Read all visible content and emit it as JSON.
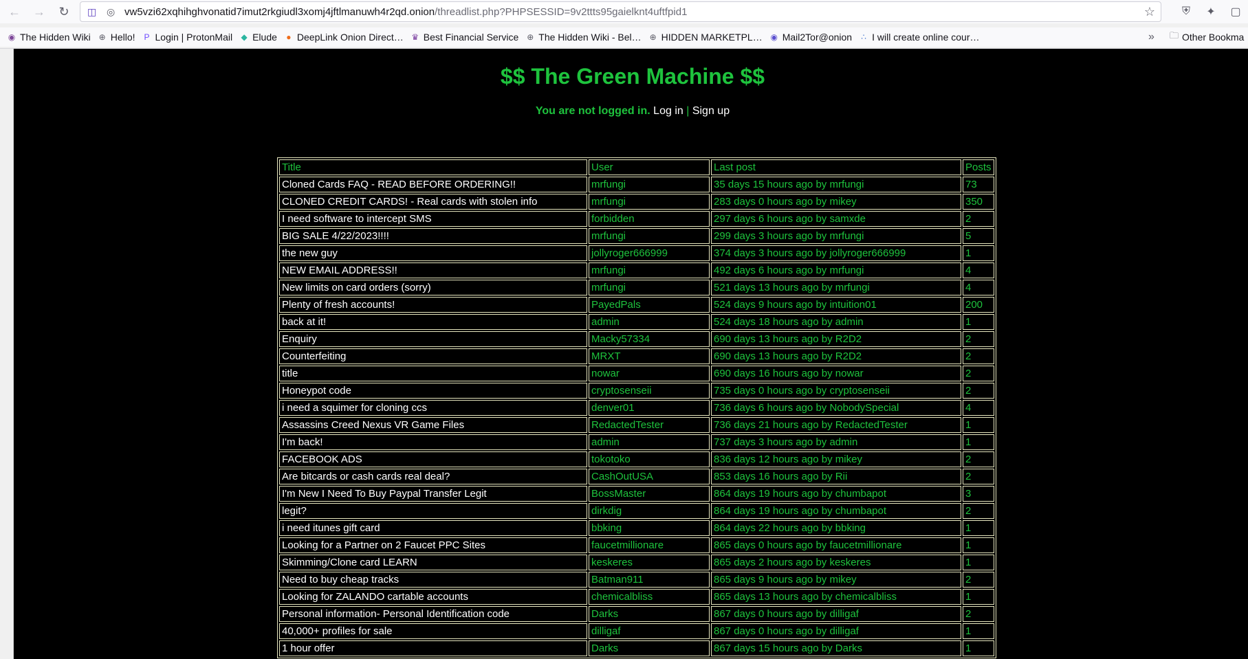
{
  "browser": {
    "url_host": "vw5vzi62xqhihghvonatid7imut2rkgiudl3xomj4jftlmanuwh4r2qd.onion",
    "url_path": "/threadlist.php?PHPSESSID=9v2ttts95gaielknt4uftfpid1",
    "icons": [
      "back-icon",
      "forward-icon",
      "reload-icon",
      "tor-circuit-icon",
      "bookmark-star-icon",
      "shield-icon",
      "magic-wand-icon",
      "extensions-icon"
    ]
  },
  "bookmarks": {
    "items": [
      {
        "label": "The Hidden Wiki",
        "icon": "onion-icon",
        "color": "#7d4698"
      },
      {
        "label": "Hello!",
        "icon": "globe-icon",
        "color": "#5b5b66"
      },
      {
        "label": "Login | ProtonMail",
        "icon": "proton-icon",
        "color": "#6d4aff"
      },
      {
        "label": "Elude",
        "icon": "elude-icon",
        "color": "#2bb5a0"
      },
      {
        "label": "DeepLink Onion Direct…",
        "icon": "deeplink-icon",
        "color": "#ef6c1a"
      },
      {
        "label": "Best Financial Service",
        "icon": "crown-icon",
        "color": "#7b3fa0"
      },
      {
        "label": "The Hidden Wiki - Bel…",
        "icon": "globe-icon",
        "color": "#5b5b66"
      },
      {
        "label": "HIDDEN MARKETPL…",
        "icon": "globe-icon",
        "color": "#5b5b66"
      },
      {
        "label": "Mail2Tor@onion",
        "icon": "mail2tor-icon",
        "color": "#5a4fcf"
      },
      {
        "label": "I will create online cour…",
        "icon": "network-icon",
        "color": "#4a7bd0"
      }
    ],
    "other_label": "Other Bookma"
  },
  "site": {
    "title": "$$ The Green Machine $$",
    "login_status": "You are not logged in.",
    "login_link": "Log in",
    "separator": "|",
    "signup_link": "Sign up"
  },
  "table": {
    "headers": {
      "title": "Title",
      "user": "User",
      "last_post": "Last post",
      "posts": "Posts"
    },
    "rows": [
      {
        "title": "Cloned Cards FAQ - READ BEFORE ORDERING!!",
        "user": "mrfungi",
        "last_post": "35 days 15 hours ago by mrfungi",
        "posts": "73"
      },
      {
        "title": "CLONED CREDIT CARDS! - Real cards with stolen info",
        "user": "mrfungi",
        "last_post": "283 days 0 hours ago by mikey",
        "posts": "350"
      },
      {
        "title": "I need software to intercept SMS",
        "user": "forbidden",
        "last_post": "297 days 6 hours ago by samxde",
        "posts": "2"
      },
      {
        "title": "BIG SALE 4/22/2023!!!!",
        "user": "mrfungi",
        "last_post": "299 days 3 hours ago by mrfungi",
        "posts": "5"
      },
      {
        "title": "the new guy",
        "user": "jollyroger666999",
        "last_post": "374 days 3 hours ago by jollyroger666999",
        "posts": "1"
      },
      {
        "title": "NEW EMAIL ADDRESS!!",
        "user": "mrfungi",
        "last_post": "492 days 6 hours ago by mrfungi",
        "posts": "4"
      },
      {
        "title": "New limits on card orders (sorry)",
        "user": "mrfungi",
        "last_post": "521 days 13 hours ago by mrfungi",
        "posts": "4"
      },
      {
        "title": "Plenty of fresh accounts!",
        "user": "PayedPals",
        "last_post": "524 days 9 hours ago by intuition01",
        "posts": "200"
      },
      {
        "title": "back at it!",
        "user": "admin",
        "last_post": "524 days 18 hours ago by admin",
        "posts": "1"
      },
      {
        "title": "Enquiry",
        "user": "Macky57334",
        "last_post": "690 days 13 hours ago by R2D2",
        "posts": "2"
      },
      {
        "title": "Counterfeiting",
        "user": "MRXT",
        "last_post": "690 days 13 hours ago by R2D2",
        "posts": "2"
      },
      {
        "title": "title",
        "user": "nowar",
        "last_post": "690 days 16 hours ago by nowar",
        "posts": "2"
      },
      {
        "title": "Honeypot code",
        "user": "cryptosenseii",
        "last_post": "735 days 0 hours ago by cryptosenseii",
        "posts": "2"
      },
      {
        "title": "i need a squimer for cloning ccs",
        "user": "denver01",
        "last_post": "736 days 6 hours ago by NobodySpecial",
        "posts": "4"
      },
      {
        "title": "Assassins Creed Nexus VR Game Files",
        "user": "RedactedTester",
        "last_post": "736 days 21 hours ago by RedactedTester",
        "posts": "1"
      },
      {
        "title": "I'm back!",
        "user": "admin",
        "last_post": "737 days 3 hours ago by admin",
        "posts": "1"
      },
      {
        "title": "FACEBOOK ADS",
        "user": "tokotoko",
        "last_post": "836 days 12 hours ago by mikey",
        "posts": "2"
      },
      {
        "title": "Are bitcards or cash cards real deal?",
        "user": "CashOutUSA",
        "last_post": "853 days 16 hours ago by Rii",
        "posts": "2"
      },
      {
        "title": "I'm New I Need To Buy Paypal Transfer Legit",
        "user": "BossMaster",
        "last_post": "864 days 19 hours ago by chumbapot",
        "posts": "3"
      },
      {
        "title": "legit?",
        "user": "dirkdig",
        "last_post": "864 days 19 hours ago by chumbapot",
        "posts": "2"
      },
      {
        "title": "i need itunes gift card",
        "user": "bbking",
        "last_post": "864 days 22 hours ago by bbking",
        "posts": "1"
      },
      {
        "title": "Looking for a Partner on 2 Faucet PPC Sites",
        "user": "faucetmillionare",
        "last_post": "865 days 0 hours ago by faucetmillionare",
        "posts": "1"
      },
      {
        "title": "Skimming/Clone card LEARN",
        "user": "keskeres",
        "last_post": "865 days 2 hours ago by keskeres",
        "posts": "1"
      },
      {
        "title": "Need to buy cheap tracks",
        "user": "Batman911",
        "last_post": "865 days 9 hours ago by mikey",
        "posts": "2"
      },
      {
        "title": "Looking for ZALANDO cartable accounts",
        "user": "chemicalbliss",
        "last_post": "865 days 13 hours ago by chemicalbliss",
        "posts": "1"
      },
      {
        "title": "Personal information- Personal Identification code",
        "user": "Darks",
        "last_post": "867 days 0 hours ago by dilligaf",
        "posts": "2"
      },
      {
        "title": "40,000+ profiles for sale",
        "user": "dilligaf",
        "last_post": "867 days 0 hours ago by dilligaf",
        "posts": "1"
      },
      {
        "title": "1 hour offer",
        "user": "Darks",
        "last_post": "867 days 15 hours ago by Darks",
        "posts": "1"
      }
    ]
  }
}
